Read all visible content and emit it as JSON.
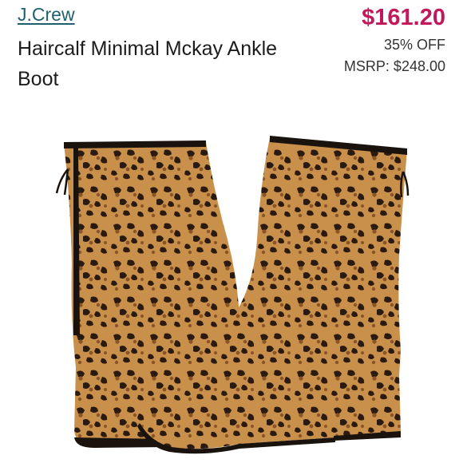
{
  "product": {
    "brand": "J.Crew",
    "title": "Haircalf Minimal Mckay Ankle Boot",
    "price": "$161.20",
    "discount": "35% OFF",
    "msrp": "MSRP: $248.00",
    "image_subject": "leopard-print-ankle-boots"
  },
  "colors": {
    "brand_link": "#1f5f6e",
    "price": "#c2185b",
    "text": "#1c1c1c",
    "boot_base": "#c8904a",
    "boot_spots": "#2a1a10"
  }
}
